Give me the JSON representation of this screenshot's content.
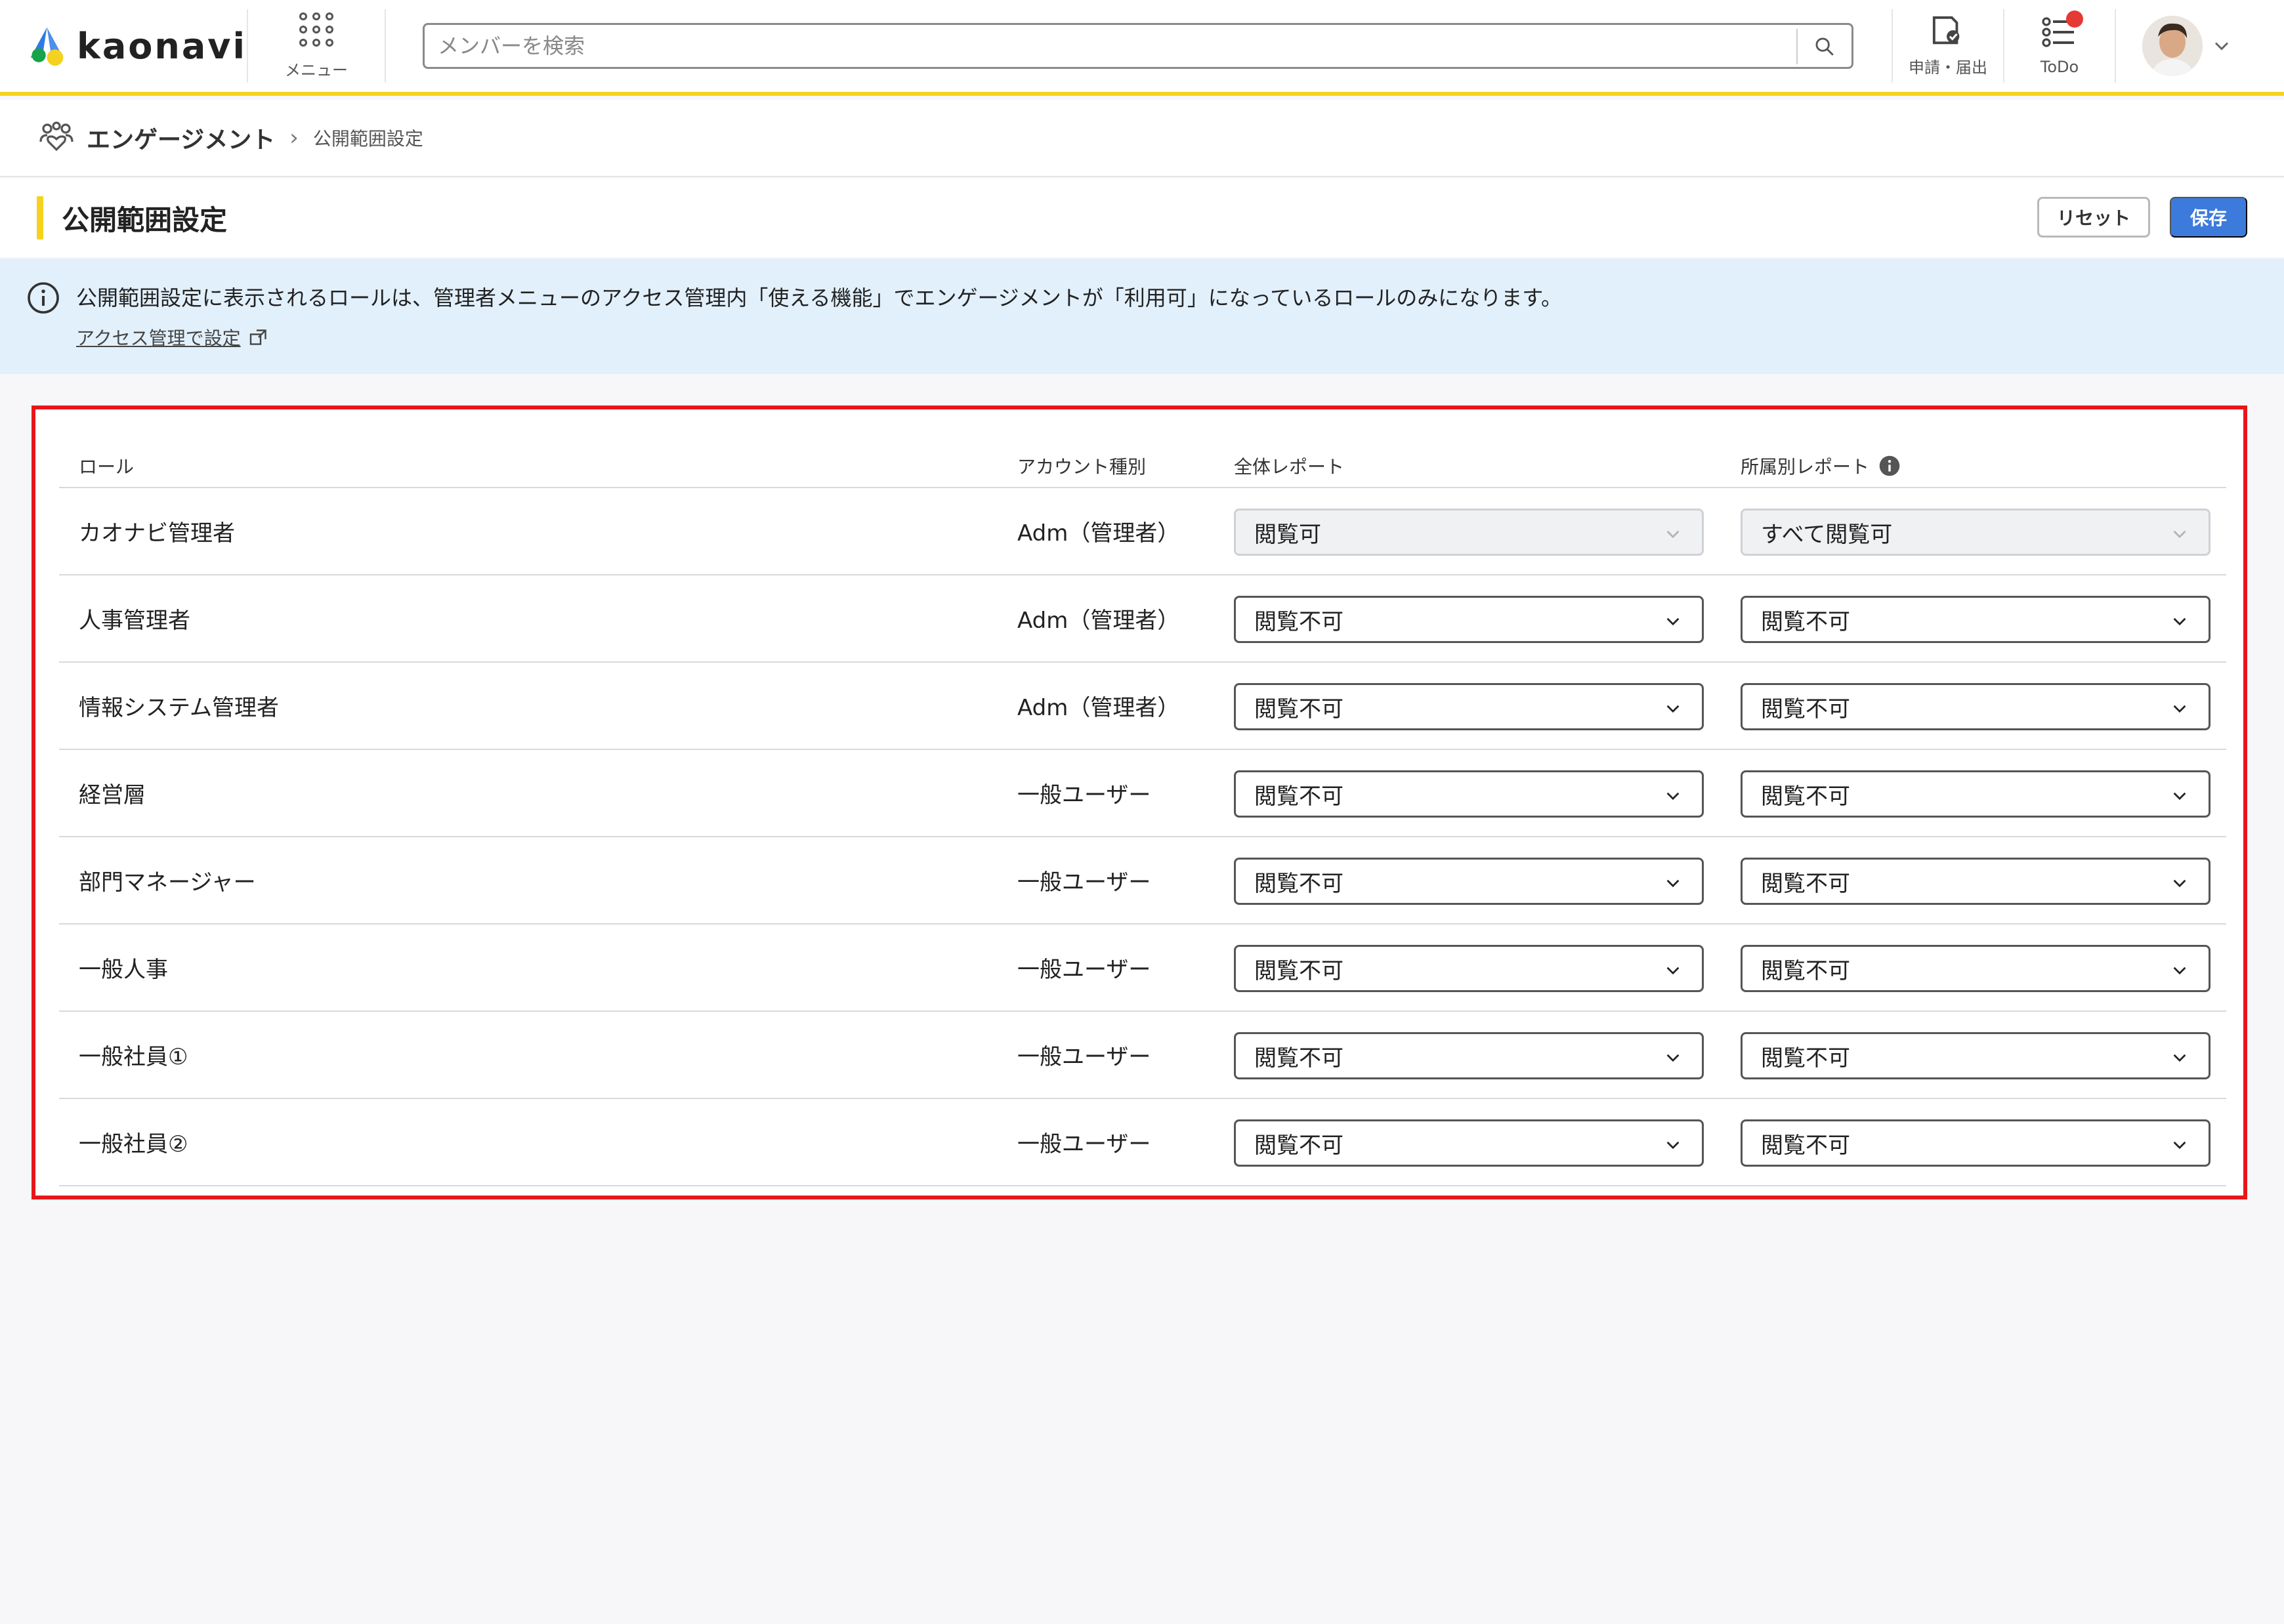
{
  "header": {
    "logo_text": "kaonavi",
    "menu_label": "メニュー",
    "search_placeholder": "メンバーを検索",
    "requests_label": "申請・届出",
    "todo_label": "ToDo"
  },
  "breadcrumb": {
    "root": "エンゲージメント",
    "separator": "›",
    "current": "公開範囲設定"
  },
  "page": {
    "title": "公開範囲設定",
    "reset_label": "リセット",
    "save_label": "保存"
  },
  "banner": {
    "message": "公開範囲設定に表示されるロールは、管理者メニューのアクセス管理内「使える機能」でエンゲージメントが「利用可」になっているロールのみになります。",
    "link_label": "アクセス管理で設定"
  },
  "table": {
    "headers": {
      "role": "ロール",
      "account_type": "アカウント種別",
      "overall_report": "全体レポート",
      "dept_report": "所属別レポート"
    },
    "rows": [
      {
        "role": "カオナビ管理者",
        "account_type": "Adm（管理者）",
        "overall": "閲覧可",
        "dept": "すべて閲覧可"
      },
      {
        "role": "人事管理者",
        "account_type": "Adm（管理者）",
        "overall": "閲覧不可",
        "dept": "閲覧不可"
      },
      {
        "role": "情報システム管理者",
        "account_type": "Adm（管理者）",
        "overall": "閲覧不可",
        "dept": "閲覧不可"
      },
      {
        "role": "経営層",
        "account_type": "一般ユーザー",
        "overall": "閲覧不可",
        "dept": "閲覧不可"
      },
      {
        "role": "部門マネージャー",
        "account_type": "一般ユーザー",
        "overall": "閲覧不可",
        "dept": "閲覧不可"
      },
      {
        "role": "一般人事",
        "account_type": "一般ユーザー",
        "overall": "閲覧不可",
        "dept": "閲覧不可"
      },
      {
        "role": "一般社員①",
        "account_type": "一般ユーザー",
        "overall": "閲覧不可",
        "dept": "閲覧不可"
      },
      {
        "role": "一般社員②",
        "account_type": "一般ユーザー",
        "overall": "閲覧不可",
        "dept": "閲覧不可"
      }
    ]
  },
  "colors": {
    "brand_yellow": "#f5d220",
    "primary_blue": "#3c7bdc",
    "highlight_red": "#e8161b",
    "banner_bg": "#e2f0fc",
    "notification_red": "#e53935"
  }
}
